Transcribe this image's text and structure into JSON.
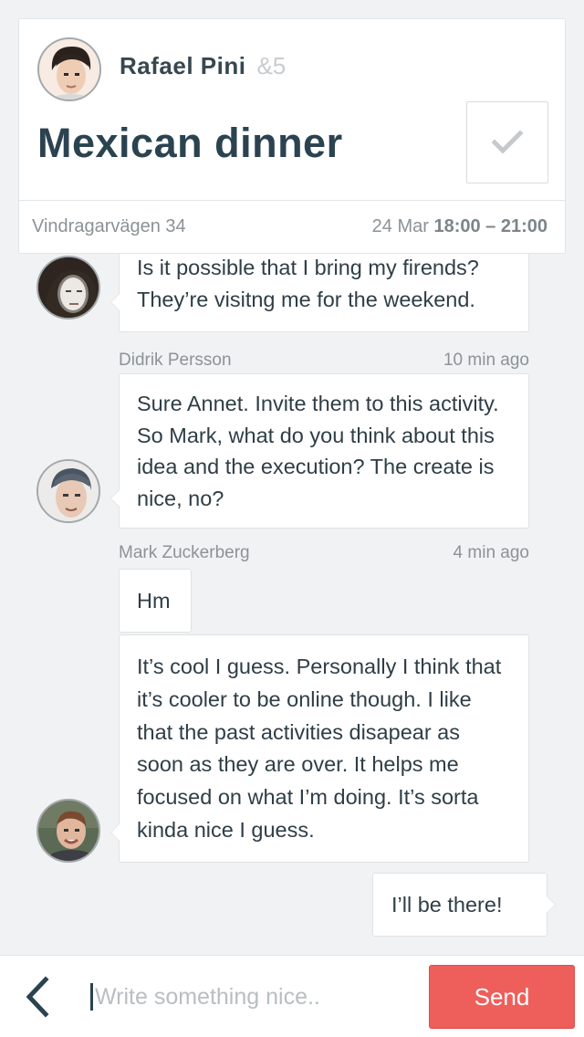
{
  "event": {
    "host_name": "Rafael Pini",
    "host_extra": "&5",
    "title": "Mexican dinner",
    "address": "Vindragarvägen 34",
    "date": "24 Mar",
    "time_range": "18:00 – 21:00"
  },
  "messages": [
    {
      "text": "Is it possible that I bring my firends? They’re visitng me for the weekend."
    },
    {
      "author": "Didrik Persson",
      "time": "10 min ago",
      "text": "Sure Annet. Invite them to this activity. So Mark, what do you think about this idea and the execution? The create is nice, no?"
    },
    {
      "author": "Mark Zuckerberg",
      "time": "4 min ago",
      "text": "Hm"
    },
    {
      "text": "It’s cool I guess. Personally I think that it’s cooler to be online though. I like that the past activities disapear as soon as they are over. It helps me focused on what I’m doing. It’s sorta kinda nice I guess."
    },
    {
      "text": "I’ll be there!"
    }
  ],
  "composer": {
    "placeholder": "Write something nice..",
    "value": "",
    "send_label": "Send"
  },
  "colors": {
    "background": "#f1f2f3",
    "title": "#2b4350",
    "send_button": "#ee5e5a"
  },
  "icons": {
    "check": "check-icon",
    "back": "chevron-left-icon"
  }
}
